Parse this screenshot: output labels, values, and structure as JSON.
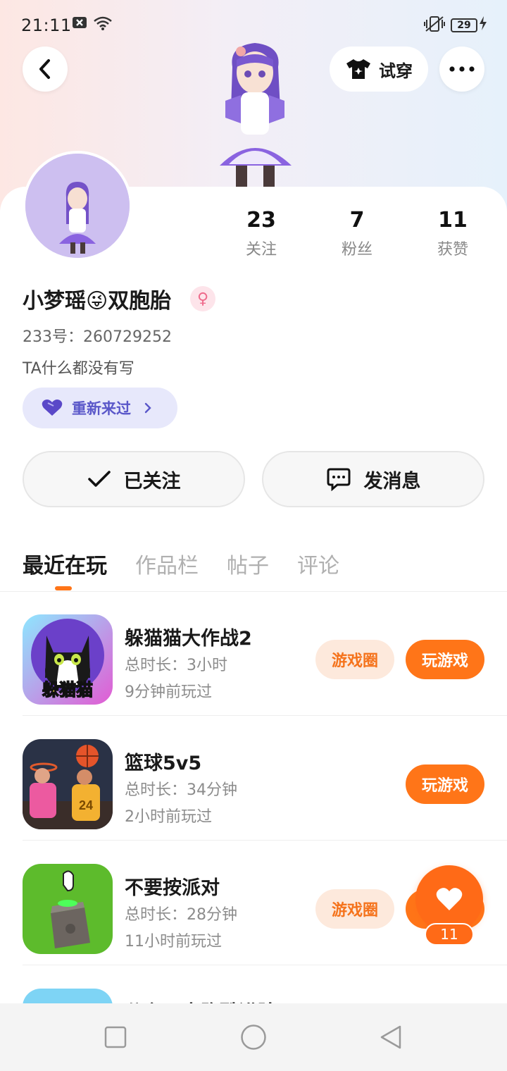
{
  "status_bar": {
    "time": "21:11",
    "battery": "29"
  },
  "header": {
    "try_on_label": "试穿"
  },
  "stats": [
    {
      "num": "23",
      "label": "关注"
    },
    {
      "num": "7",
      "label": "粉丝"
    },
    {
      "num": "11",
      "label": "获赞"
    }
  ],
  "profile": {
    "nickname": "小梦瑶😜双胞胎",
    "gender_symbol": "♀",
    "uid": "233号：260729252",
    "bio": "TA什么都没有写",
    "restart_label": "重新来过"
  },
  "actions": {
    "follow_label": "已关注",
    "message_label": "发消息"
  },
  "tabs": [
    {
      "label": "最近在玩"
    },
    {
      "label": "作品栏"
    },
    {
      "label": "帖子"
    },
    {
      "label": "评论"
    }
  ],
  "games": [
    {
      "title": "躲猫猫大作战2",
      "duration": "总时长：3小时",
      "last_played": "9分钟前玩过",
      "icon_text": "躲猫猫",
      "circle_label": "游戏圈",
      "play_label": "玩游戏"
    },
    {
      "title": "篮球5v5",
      "duration": "总时长：34分钟",
      "last_played": "2小时前玩过",
      "play_label": "玩游戏"
    },
    {
      "title": "不要按派对",
      "duration": "总时长：28分钟",
      "last_played": "11小时前玩过",
      "circle_label": "游戏圈",
      "play_label": "玩游戏"
    },
    {
      "title": "公主双人跑酷进阶"
    }
  ],
  "like_fab": {
    "count": "11"
  }
}
